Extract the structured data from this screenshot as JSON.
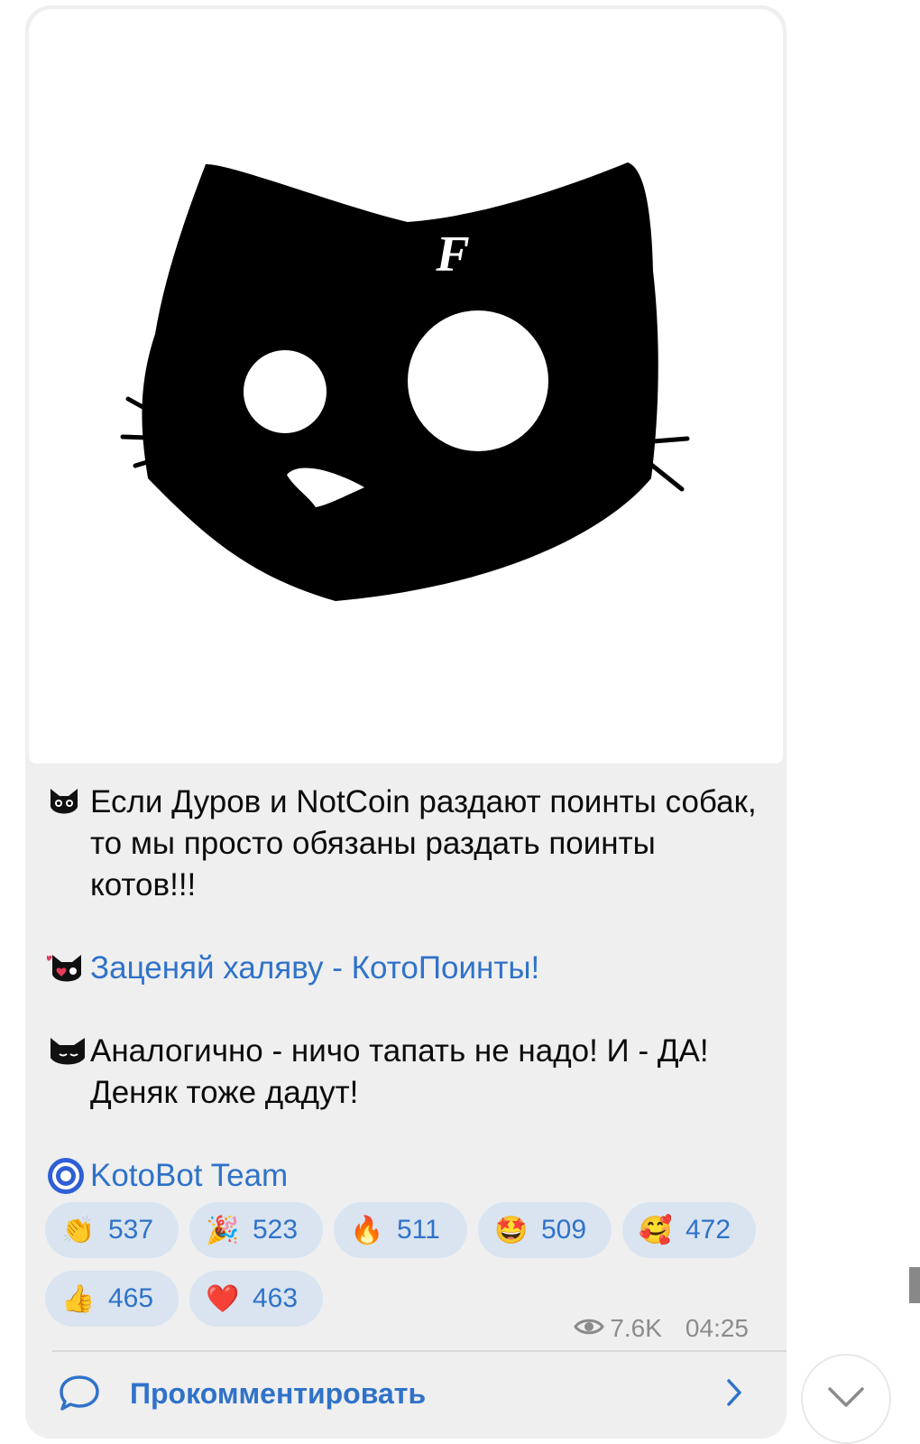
{
  "post": {
    "paragraphs": [
      {
        "icon": "cat-face-emoji",
        "text": "Если Дуров и NotCoin раздают поинты собак, то мы просто обязаны раздать поинты котов!!!"
      },
      {
        "icon": "cat-heart-emoji",
        "text": "Заценяй халяву - КотоПоинты!",
        "is_link": true
      },
      {
        "icon": "sleepy-cat-emoji",
        "text": "Аналогично - ничо тапать не надо! И - ДА! Деняк тоже дадут!"
      }
    ],
    "signature": {
      "icon": "kotobot-logo-icon",
      "text": "KotoBot Team"
    },
    "image_mark": "F"
  },
  "reactions": [
    {
      "icon": "clapping-hands-icon",
      "emoji": "👏",
      "count": "537"
    },
    {
      "icon": "party-popper-icon",
      "emoji": "🎉",
      "count": "523"
    },
    {
      "icon": "fire-icon",
      "emoji": "🔥",
      "count": "511"
    },
    {
      "icon": "star-struck-icon",
      "emoji": "🤩",
      "count": "509"
    },
    {
      "icon": "smiling-hearts-icon",
      "emoji": "🥰",
      "count": "472"
    },
    {
      "icon": "thumbs-up-icon",
      "emoji": "👍",
      "count": "465"
    },
    {
      "icon": "red-heart-icon",
      "emoji": "❤️",
      "count": "463"
    }
  ],
  "meta": {
    "views": "7.6K",
    "time": "04:25"
  },
  "comments": {
    "label": "Прокомментировать"
  },
  "colors": {
    "accent": "#2f72c9",
    "bubble": "#efefef",
    "reaction_bg": "#d9e4f0"
  }
}
